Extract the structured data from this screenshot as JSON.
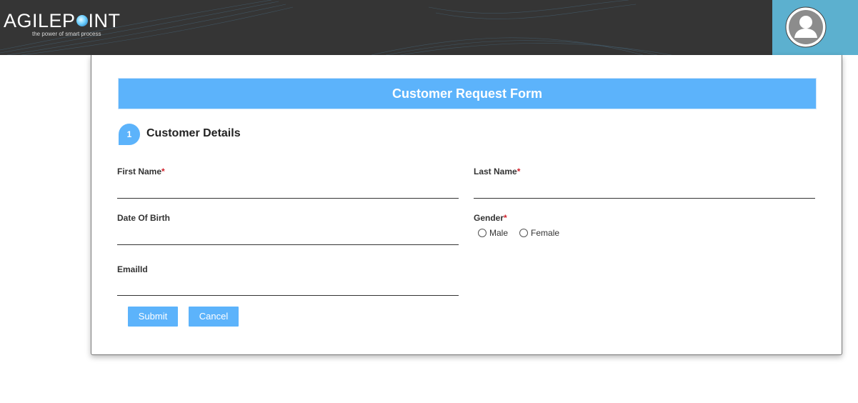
{
  "brand": {
    "logo_text_pre": "AGILEP",
    "logo_text_post": "INT",
    "tagline": "the power of smart process"
  },
  "form": {
    "title": "Customer Request Form",
    "section": {
      "step": "1",
      "title": "Customer Details"
    },
    "fields": {
      "first_name": {
        "label": "First Name",
        "required": "*",
        "value": ""
      },
      "last_name": {
        "label": "Last Name",
        "required": "*",
        "value": ""
      },
      "dob": {
        "label": "Date Of Birth",
        "value": ""
      },
      "gender": {
        "label": "Gender",
        "required": "*",
        "options": [
          "Male",
          "Female"
        ]
      },
      "email": {
        "label": "EmailId",
        "value": ""
      }
    },
    "buttons": {
      "submit": "Submit",
      "cancel": "Cancel"
    }
  },
  "colors": {
    "topbar": "#353535",
    "avatar_bg": "#5cb0cf",
    "accent": "#5cb3fb",
    "required": "#d0202a"
  },
  "icons": {
    "avatar": "user-avatar-icon",
    "logo_orb": "orb-icon"
  }
}
